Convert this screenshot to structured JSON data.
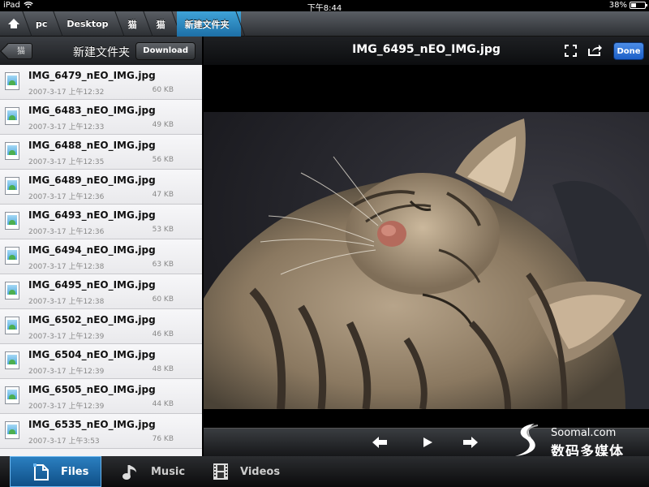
{
  "status": {
    "device": "iPad",
    "time": "下午8:44",
    "battery": "38%",
    "battery_level": 0.38
  },
  "breadcrumb": {
    "items": [
      "pc",
      "Desktop",
      "猫",
      "猫"
    ],
    "active": "新建文件夹"
  },
  "sidebar": {
    "back_label": "猫",
    "title": "新建文件夹",
    "download_label": "Download",
    "files": [
      {
        "name": "IMG_6479_nEO_IMG.jpg",
        "date": "2007-3-17 上午12:32",
        "size": "60 KB"
      },
      {
        "name": "IMG_6483_nEO_IMG.jpg",
        "date": "2007-3-17 上午12:33",
        "size": "49 KB"
      },
      {
        "name": "IMG_6488_nEO_IMG.jpg",
        "date": "2007-3-17 上午12:35",
        "size": "56 KB"
      },
      {
        "name": "IMG_6489_nEO_IMG.jpg",
        "date": "2007-3-17 上午12:36",
        "size": "47 KB"
      },
      {
        "name": "IMG_6493_nEO_IMG.jpg",
        "date": "2007-3-17 上午12:36",
        "size": "53 KB"
      },
      {
        "name": "IMG_6494_nEO_IMG.jpg",
        "date": "2007-3-17 上午12:38",
        "size": "63 KB"
      },
      {
        "name": "IMG_6495_nEO_IMG.jpg",
        "date": "2007-3-17 上午12:38",
        "size": "60 KB"
      },
      {
        "name": "IMG_6502_nEO_IMG.jpg",
        "date": "2007-3-17 上午12:39",
        "size": "46 KB"
      },
      {
        "name": "IMG_6504_nEO_IMG.jpg",
        "date": "2007-3-17 上午12:39",
        "size": "48 KB"
      },
      {
        "name": "IMG_6505_nEO_IMG.jpg",
        "date": "2007-3-17 上午12:39",
        "size": "44 KB"
      },
      {
        "name": "IMG_6535_nEO_IMG.jpg",
        "date": "2007-3-17 上午3:53",
        "size": "76 KB"
      }
    ]
  },
  "viewer": {
    "title": "IMG_6495_nEO_IMG.jpg",
    "done_label": "Done",
    "icons": [
      "fullscreen-icon",
      "share-icon",
      "previous-arrow-icon",
      "play-icon",
      "next-arrow-icon"
    ]
  },
  "watermark": {
    "brand": "Soomal.com",
    "subtitle": "数码多媒体"
  },
  "tabs": [
    {
      "label": "Files",
      "icon": "files-icon",
      "active": true
    },
    {
      "label": "Music",
      "icon": "music-note-icon",
      "active": false
    },
    {
      "label": "Videos",
      "icon": "film-icon",
      "active": false
    }
  ],
  "colors": {
    "accent": "#1d6fa6",
    "done_button": "#2a6fd6",
    "tab_active": "#1b6aa8"
  }
}
